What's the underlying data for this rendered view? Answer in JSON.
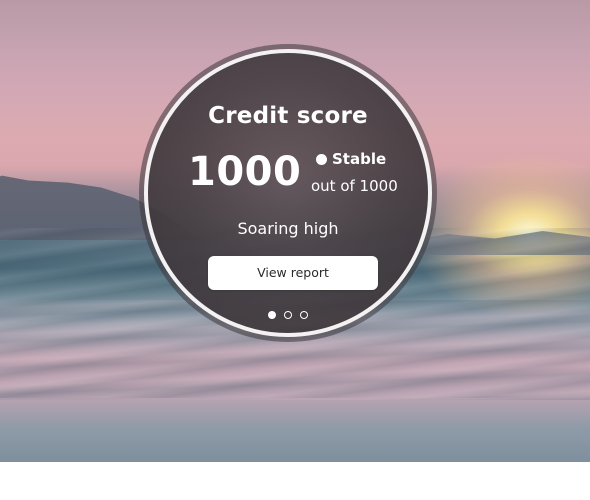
{
  "card": {
    "title": "Credit score",
    "score": "1000",
    "status_label": "Stable",
    "out_of": "out of 1000",
    "tagline": "Soaring high",
    "button_label": "View report"
  },
  "pager": {
    "count": 3,
    "active_index": 0
  },
  "colors": {
    "card_background": "#463f43",
    "ring_border": "#f4f1f2",
    "button_background": "#ffffff",
    "button_text": "#2b2b2b",
    "text": "#ffffff"
  }
}
